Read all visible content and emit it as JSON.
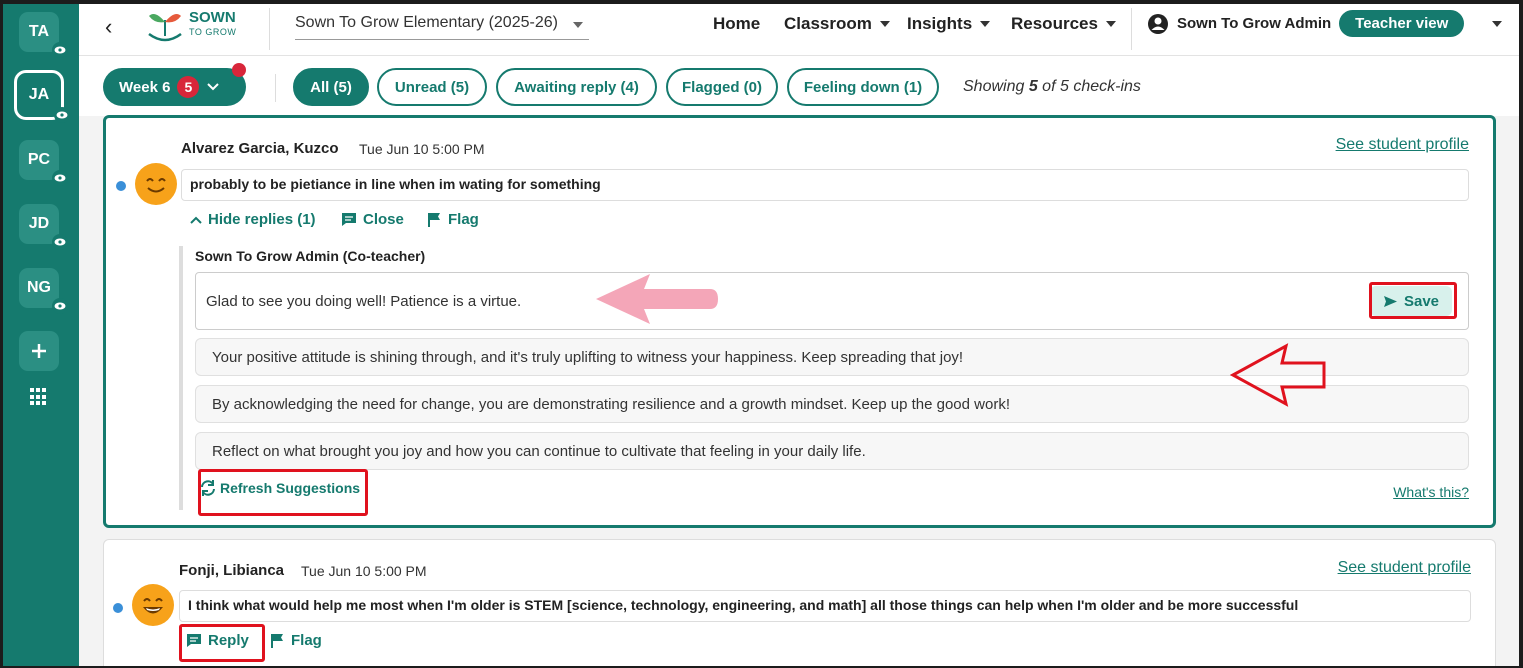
{
  "rail": {
    "avatars": [
      {
        "initials": "TA"
      },
      {
        "initials": "JA"
      },
      {
        "initials": "PC"
      },
      {
        "initials": "JD"
      },
      {
        "initials": "NG"
      }
    ]
  },
  "topnav": {
    "logo_line1": "SOWN",
    "logo_line2": "TO GROW",
    "school": "Sown To Grow Elementary (2025-26)",
    "nav": [
      "Home",
      "Classroom",
      "Insights",
      "Resources"
    ],
    "user_name": "Sown To Grow Admin",
    "view_button": "Teacher view"
  },
  "filters": {
    "week_label": "Week 6",
    "week_count": "5",
    "pills": [
      "All (5)",
      "Unread (5)",
      "Awaiting reply (4)",
      "Flagged (0)",
      "Feeling down (1)"
    ],
    "showing_prefix": "Showing ",
    "showing_count": "5",
    "showing_suffix": " of 5 check-ins"
  },
  "checkins": [
    {
      "student": "Alvarez Garcia, Kuzco",
      "date": "Tue Jun 10 5:00 PM",
      "profile_link": "See student profile",
      "message": "probably to be pietiance in line when im wating for something",
      "hide_replies": "Hide replies (1)",
      "close": "Close",
      "flag": "Flag",
      "reply_author": "Sown To Grow Admin (Co-teacher)",
      "reply_text": "Glad to see you doing well! Patience is a virtue.",
      "save": "Save",
      "suggestions": [
        "Your positive attitude is shining through, and it's truly uplifting to witness your happiness. Keep spreading that joy!",
        "By acknowledging the need for change, you are demonstrating resilience and a growth mindset. Keep up the good work!",
        "Reflect on what brought you joy and how you can continue to cultivate that feeling in your daily life."
      ],
      "refresh": "Refresh Suggestions",
      "whats_this": "What's this?"
    },
    {
      "student": "Fonji, Libianca",
      "date": "Tue Jun 10 5:00 PM",
      "profile_link": "See student profile",
      "message": "I think what would help me most when I'm older is STEM [science, technology, engineering, and math] all those things can help when I'm older and be more successful",
      "reply": "Reply",
      "flag": "Flag"
    }
  ],
  "colors": {
    "brand": "#157a6e",
    "alert": "#d8263a",
    "annotation": "#e0121e",
    "arrow_fill": "#f4a6b8"
  }
}
